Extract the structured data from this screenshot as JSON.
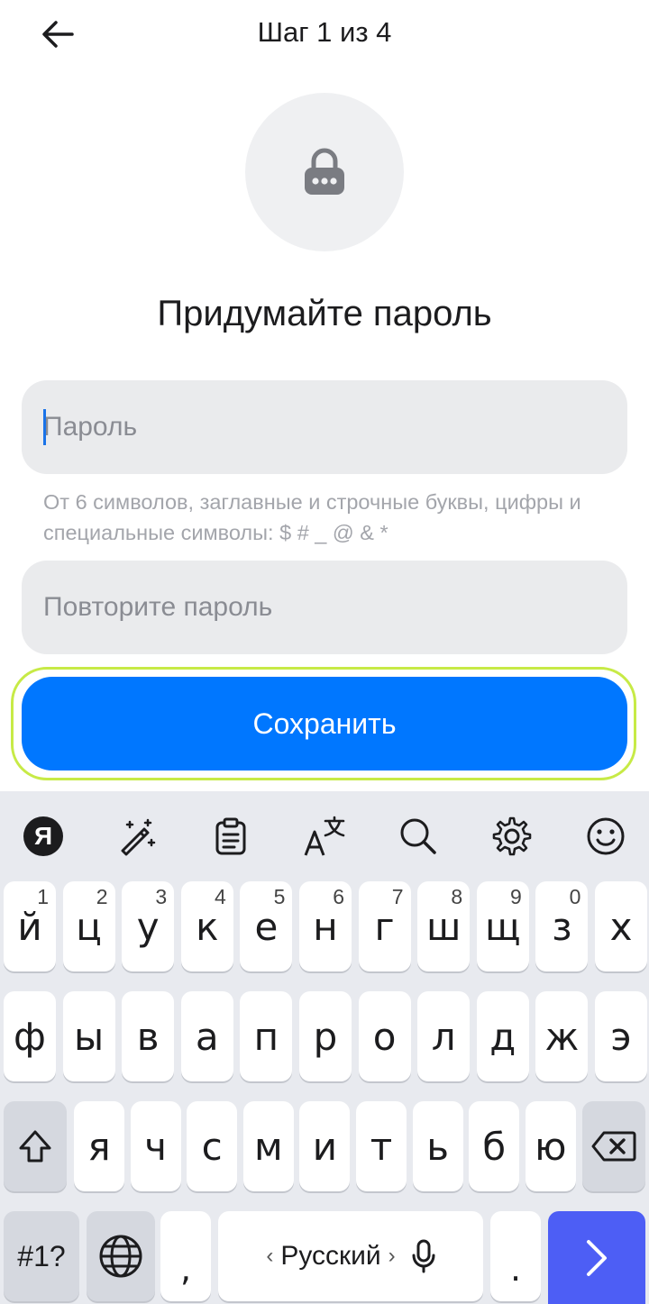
{
  "header": {
    "step_label": "Шаг 1 из 4",
    "back_icon": "arrow-left-icon"
  },
  "lock": {
    "icon": "lock-icon"
  },
  "page": {
    "heading": "Придумайте пароль"
  },
  "form": {
    "password_placeholder": "Пароль",
    "password_value": "",
    "hint": "От 6 символов, заглавные и строчные буквы, цифры и специальные символы: $ # _ @ & *",
    "repeat_placeholder": "Повторите пароль",
    "repeat_value": ""
  },
  "save_button": {
    "label": "Сохранить"
  },
  "keyboard": {
    "toolbar": [
      "yandex-logo-icon",
      "magic-wand-icon",
      "clipboard-icon",
      "translate-icon",
      "search-icon",
      "gear-icon",
      "smiley-icon"
    ],
    "yandex_logo_text": "Я",
    "row1": [
      {
        "char": "й",
        "num": "1"
      },
      {
        "char": "ц",
        "num": "2"
      },
      {
        "char": "у",
        "num": "3"
      },
      {
        "char": "к",
        "num": "4"
      },
      {
        "char": "е",
        "num": "5"
      },
      {
        "char": "н",
        "num": "6"
      },
      {
        "char": "г",
        "num": "7"
      },
      {
        "char": "ш",
        "num": "8"
      },
      {
        "char": "щ",
        "num": "9"
      },
      {
        "char": "з",
        "num": "0"
      },
      {
        "char": "х",
        "num": ""
      }
    ],
    "row2": [
      "ф",
      "ы",
      "в",
      "а",
      "п",
      "р",
      "о",
      "л",
      "д",
      "ж",
      "э"
    ],
    "row3": [
      "я",
      "ч",
      "с",
      "м",
      "и",
      "т",
      "ь",
      "б",
      "ю"
    ],
    "symbols_label": "#1?",
    "comma": ",",
    "period": ".",
    "space_label": "Русский",
    "space_left": "‹",
    "space_right": "›",
    "colors": {
      "accent": "#0077ff",
      "enter": "#4d5ef5",
      "highlight": "#c7ea46"
    }
  }
}
